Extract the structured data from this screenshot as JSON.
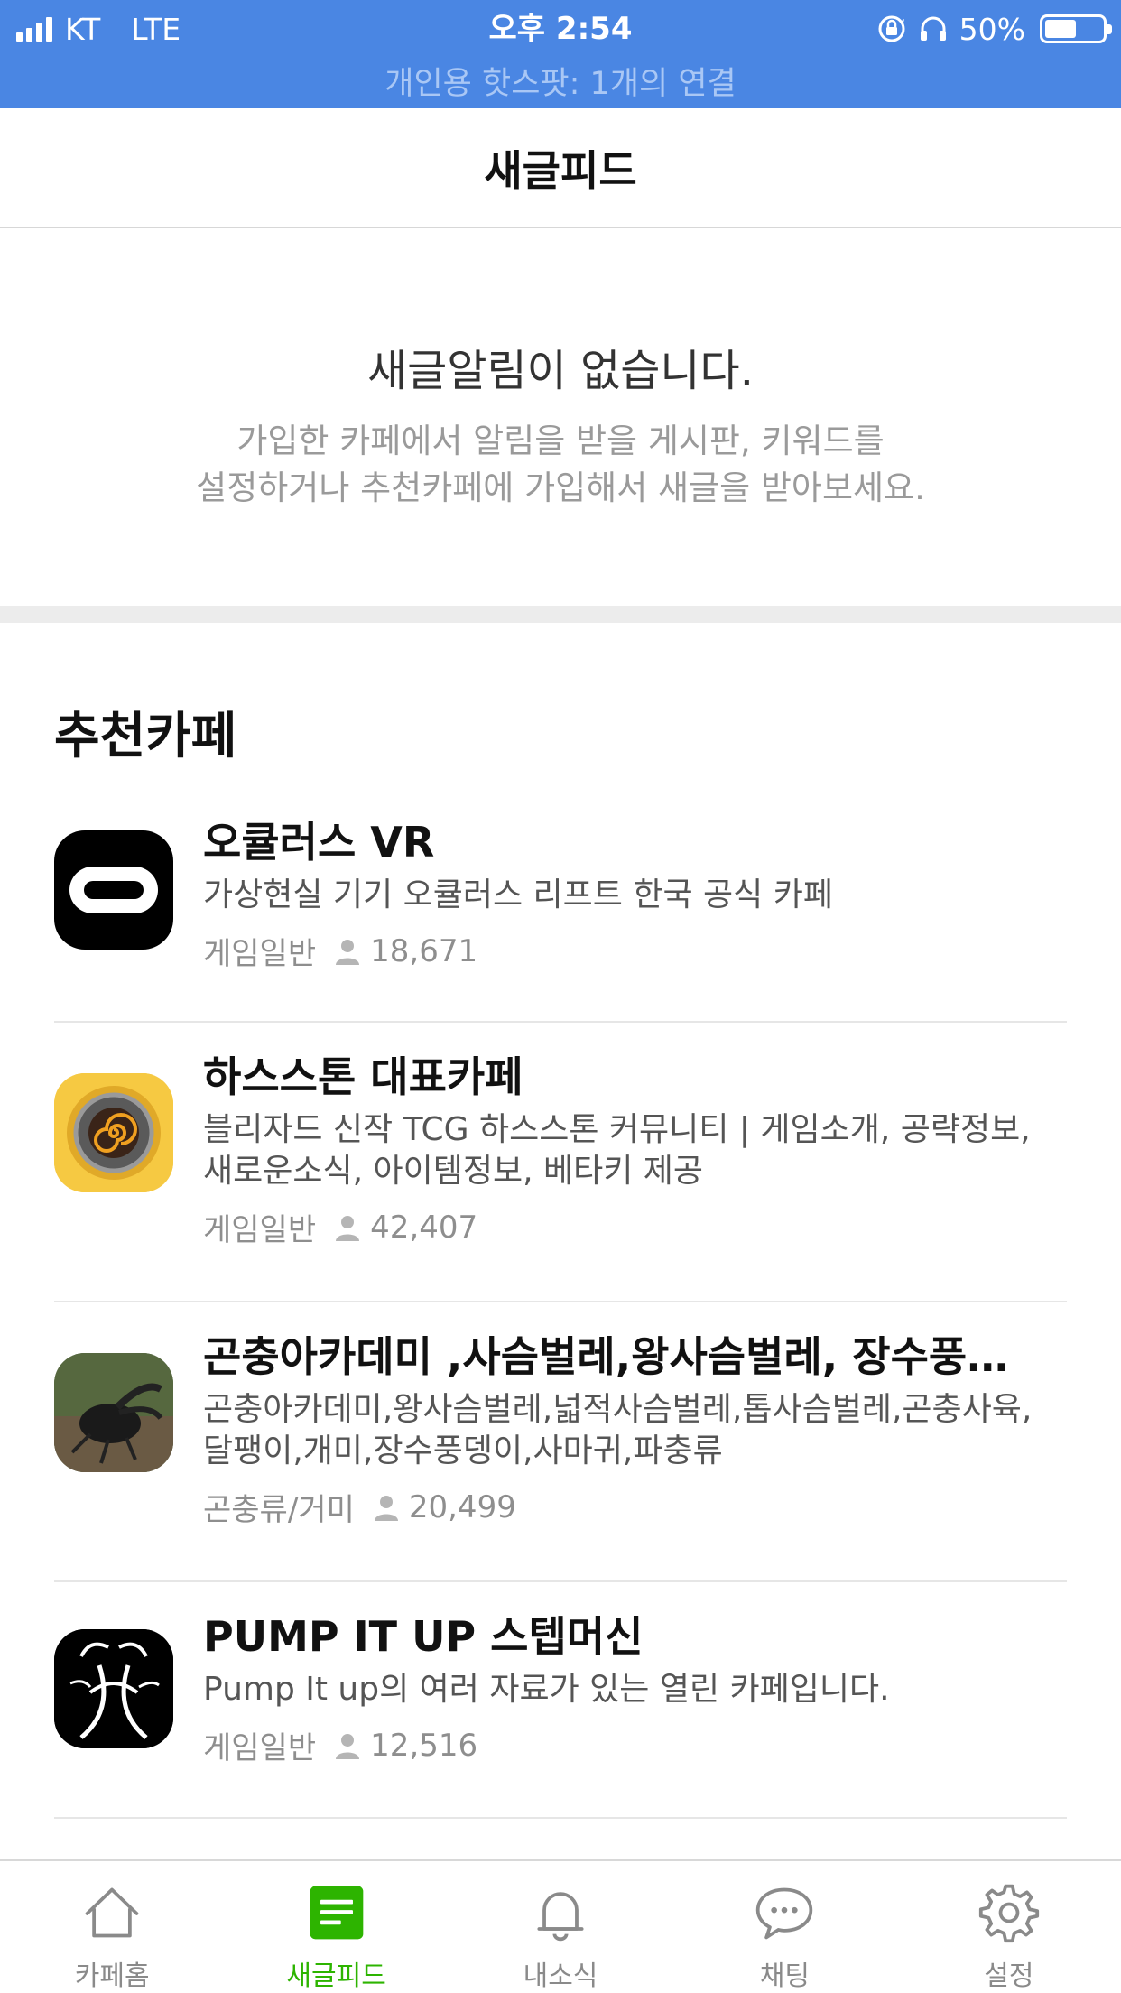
{
  "status_bar": {
    "carrier": "KT",
    "network": "LTE",
    "time": "오후 2:54",
    "battery": "50%",
    "battery_level": 0.5,
    "hotspot": "개인용 핫스팟: 1개의 연결"
  },
  "header": {
    "title": "새글피드"
  },
  "empty_state": {
    "title": "새글알림이 없습니다.",
    "desc_line1": "가입한 카페에서 알림을 받을 게시판, 키워드를",
    "desc_line2": "설정하거나 추천카페에 가입해서 새글을 받아보세요."
  },
  "recommend": {
    "title": "추천카페",
    "cafes": [
      {
        "name": "오큘러스 VR",
        "desc_lines": [
          "가상현실 기기 오큘러스 리프트 한국 공식 카페"
        ],
        "category": "게임일반",
        "members": "18,671",
        "icon": "oculus-logo"
      },
      {
        "name": "하스스톤 대표카페",
        "desc_lines": [
          "블리자드 신작 TCG 하스스톤 커뮤니티 | 게임소개, 공략정보,",
          "새로운소식,  아이템정보, 베타키 제공"
        ],
        "category": "게임일반",
        "members": "42,407",
        "icon": "hearthstone-logo"
      },
      {
        "name": "곤충아카데미 ,사슴벌레,왕사슴벌레, 장수풍뎅이",
        "desc_lines": [
          "곤충아카데미,왕사슴벌레,넓적사슴벌레,톱사슴벌레,곤충사육,",
          "달팽이,개미,장수풍뎅이,사마귀,파충류"
        ],
        "category": "곤충류/거미",
        "members": "20,499",
        "icon": "stag-beetle-photo"
      },
      {
        "name": "PUMP IT UP 스텝머신",
        "desc_lines": [
          "Pump It up의 여러 자료가 있는 열린 카페입니다."
        ],
        "category": "게임일반",
        "members": "12,516",
        "icon": "pump-it-up-logo"
      }
    ]
  },
  "tabbar": {
    "tabs": [
      {
        "label": "카페홈",
        "icon": "home-icon"
      },
      {
        "label": "새글피드",
        "icon": "feed-icon",
        "active": true
      },
      {
        "label": "내소식",
        "icon": "bell-icon"
      },
      {
        "label": "채팅",
        "icon": "chat-icon"
      },
      {
        "label": "설정",
        "icon": "gear-icon"
      }
    ]
  },
  "colors": {
    "status_bar_bg": "#4a86e3",
    "active_tab": "#2db400",
    "inactive_tab": "#8a8a8a"
  }
}
